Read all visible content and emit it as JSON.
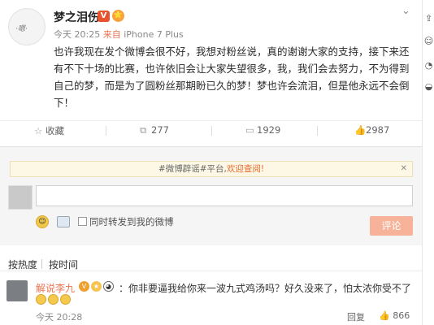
{
  "post": {
    "author": "梦之泪伤",
    "avatar_signature": "·嗯·",
    "verified_badge": "V",
    "level_badge": "⭐",
    "time": "今天 20:25",
    "source_prefix": "来自",
    "source_device": "iPhone 7 Plus",
    "text": "也许我现在发个微博会很不好，我想对粉丝说，真的谢谢大家的支持，接下来还有不下十场的比赛，也许依旧会让大家失望很多，我，我们会去努力，不为得到自己的梦，而是为了圆粉丝那期盼已久的梦！梦也许会流泪，但是他永远不会倒下！",
    "more_icon": "chevron-down-icon"
  },
  "actions": {
    "favorite": "收藏",
    "repost_count": "277",
    "comment_count": "1929",
    "like_count": "2987"
  },
  "comment_box": {
    "notice_prefix": "#微博辟谣#平台,",
    "notice_link": "欢迎查阅!",
    "repost_label": "同时转发到我的微博",
    "submit_label": "评论"
  },
  "sort_tabs": [
    "按热度",
    "按时间"
  ],
  "comments": [
    {
      "author": "解说李九",
      "text": "：你非要逼我给你来一波九式鸡汤吗？好久没来了，怕太浓你受不了",
      "time": "今天 20:28",
      "reply_label": "回复",
      "likes": "866"
    }
  ],
  "colors": {
    "accent": "#eb7350",
    "submit_disabled": "#f7b39a",
    "notice_bg": "#fdf8e5"
  }
}
